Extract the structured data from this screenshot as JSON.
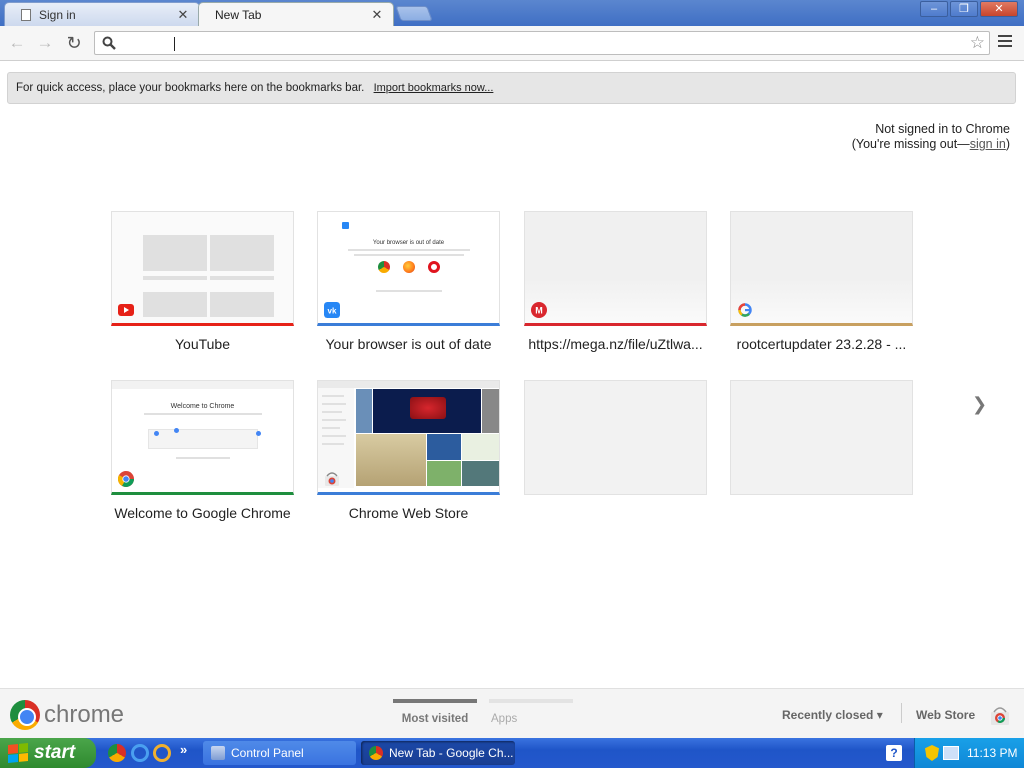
{
  "window": {
    "tabs": [
      {
        "label": "Sign in",
        "active": false
      },
      {
        "label": "New Tab",
        "active": true
      }
    ],
    "controls": {
      "minimize": "–",
      "restore": "❐",
      "close": "✕"
    }
  },
  "toolbar": {
    "back_icon": "arrow-left-icon",
    "forward_icon": "arrow-right-icon",
    "reload_icon": "reload-icon",
    "omnibox_value": "",
    "omnibox_placeholder": "",
    "star_icon": "star-icon",
    "menu_icon": "hamburger-menu-icon"
  },
  "bookmarks_prompt": {
    "text": "For quick access, place your bookmarks here on the bookmarks bar.",
    "link": "Import bookmarks now..."
  },
  "signin": {
    "line1": "Not signed in to Chrome",
    "line2_prefix": "(You're missing out—",
    "link": "sign in",
    "line2_suffix": ")"
  },
  "most_visited": [
    {
      "title": "YouTube",
      "favicon": "youtube-icon",
      "accent": "#e62117"
    },
    {
      "title": "Your browser is out of date",
      "favicon": "vk-icon",
      "accent": "#3b7dd8"
    },
    {
      "title": "https://mega.nz/file/uZtlwa...",
      "favicon": "mega-icon",
      "accent": "#d9272e"
    },
    {
      "title": "rootcertupdater 23.2.28 - ...",
      "favicon": "google-icon",
      "accent": "#c8a060"
    },
    {
      "title": "Welcome to Google Chrome",
      "favicon": "chrome-icon",
      "accent": "#1e8e3e"
    },
    {
      "title": "Chrome Web Store",
      "favicon": "chrome-web-store-icon",
      "accent": "#3b7dd8"
    },
    {
      "title": "",
      "favicon": "",
      "accent": "#e2e2e2"
    },
    {
      "title": "",
      "favicon": "",
      "accent": "#e2e2e2"
    }
  ],
  "thumb_text": {
    "vk_heading": "Your browser is out of date",
    "chrome_heading": "Welcome to Chrome"
  },
  "footer": {
    "brand": "chrome",
    "tabs": [
      {
        "label": "Most visited",
        "active": true
      },
      {
        "label": "Apps",
        "active": false
      }
    ],
    "recently_closed": "Recently closed ▾",
    "web_store": "Web Store"
  },
  "taskbar": {
    "start": "start",
    "quicklaunch_more": "»",
    "buttons": [
      {
        "label": "Control Panel",
        "active": false
      },
      {
        "label": "New Tab - Google Ch...",
        "active": true
      }
    ],
    "help": "?",
    "clock": "11:13 PM"
  },
  "colors": {
    "titlebar": "#3f6fc4",
    "taskbar": "#2458cc",
    "start": "#2f8a2f",
    "tray": "#0f87d6"
  }
}
